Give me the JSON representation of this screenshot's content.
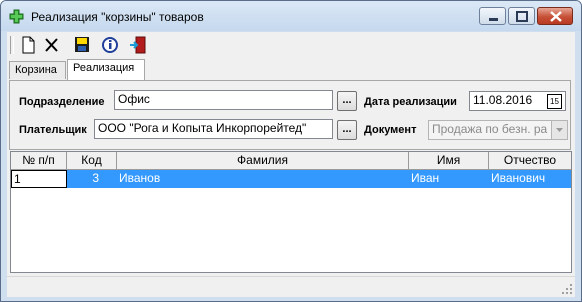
{
  "window": {
    "title": "Реализация \"корзины\" товаров"
  },
  "toolbar": {
    "buttons": [
      {
        "name": "new-document-icon"
      },
      {
        "name": "delete-icon"
      },
      {
        "name": "save-icon"
      },
      {
        "name": "info-icon"
      },
      {
        "name": "exit-door-icon"
      }
    ]
  },
  "tabs": [
    {
      "label": "Корзина"
    },
    {
      "label": "Реализация"
    }
  ],
  "form": {
    "department_label": "Подразделение",
    "department_value": "Офис",
    "payer_label": "Плательщик",
    "payer_value": "ООО \"Рога и Копыта Инкорпорейтед\"",
    "browse_label": "...",
    "date_label": "Дата реализации",
    "date_value": "11.08.2016",
    "calendar_icon_text": "15",
    "document_label": "Документ",
    "document_value": "Продажа по безн. ра"
  },
  "table": {
    "columns": [
      "№ п/п",
      "Код",
      "Фамилия",
      "Имя",
      "Отчество"
    ],
    "rows": [
      {
        "num": "1",
        "code": "3",
        "last_name": "Иванов",
        "first_name": "Иван",
        "patronymic": "Иванович"
      }
    ]
  },
  "colors": {
    "selection": "#3399ff",
    "title_bar": "#c9dbef",
    "close_button": "#c65036"
  }
}
